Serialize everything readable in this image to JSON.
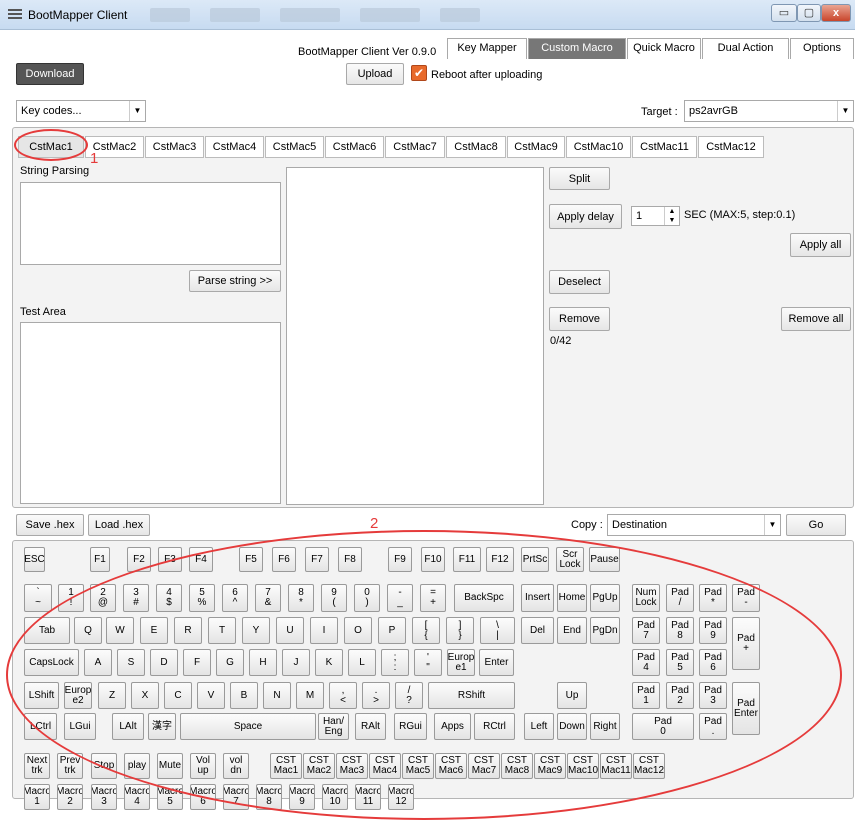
{
  "window": {
    "title": "BootMapper Client",
    "min": "▭",
    "max": "▢",
    "close": "x"
  },
  "header": {
    "version": "BootMapper Client Ver 0.9.0"
  },
  "tabs": [
    "Key Mapper",
    "Custom Macro",
    "Quick Macro",
    "Dual Action",
    "Options"
  ],
  "toolbar": {
    "download": "Download",
    "upload": "Upload",
    "reboot_label": "Reboot after uploading",
    "reboot_checked": true,
    "keycodes": "Key codes...",
    "target_label": "Target :",
    "target_value": "ps2avrGB"
  },
  "macro_tabs": [
    "CstMac1",
    "CstMac2",
    "CstMac3",
    "CstMac4",
    "CstMac5",
    "CstMac6",
    "CstMac7",
    "CstMac8",
    "CstMac9",
    "CstMac10",
    "CstMac11",
    "CstMac12"
  ],
  "macro": {
    "string_parsing": "String Parsing",
    "parse_button": "Parse string >>",
    "test_area": "Test Area",
    "split": "Split",
    "apply_delay": "Apply delay",
    "delay_value": "1",
    "sec_label": "SEC (MAX:5, step:0.1)",
    "apply_all": "Apply all",
    "deselect": "Deselect",
    "remove": "Remove",
    "remove_all": "Remove all",
    "counter": "0/42"
  },
  "bottom": {
    "save_hex": "Save .hex",
    "load_hex": "Load .hex",
    "copy_label": "Copy :",
    "destination": "Destination",
    "go": "Go"
  },
  "annotations": {
    "one": "1",
    "two": "2"
  },
  "keys": [
    {
      "l": "ESC"
    },
    {
      "l": "F1"
    },
    {
      "l": "F2"
    },
    {
      "l": "F3"
    },
    {
      "l": "F4"
    },
    {
      "l": "F5"
    },
    {
      "l": "F6"
    },
    {
      "l": "F7"
    },
    {
      "l": "F8"
    },
    {
      "l": "F9"
    },
    {
      "l": "F10"
    },
    {
      "l": "F11"
    },
    {
      "l": "F12"
    },
    {
      "l": "PrtSc"
    },
    {
      "l": "Scr\nLock"
    },
    {
      "l": "Pause"
    },
    {
      "l": "`\n~"
    },
    {
      "l": "1\n!"
    },
    {
      "l": "2\n@"
    },
    {
      "l": "3\n#"
    },
    {
      "l": "4\n$"
    },
    {
      "l": "5\n%"
    },
    {
      "l": "6\n^"
    },
    {
      "l": "7\n&"
    },
    {
      "l": "8\n*"
    },
    {
      "l": "9\n("
    },
    {
      "l": "0\n)"
    },
    {
      "l": "-\n_"
    },
    {
      "l": "=\n+"
    },
    {
      "l": "BackSpc"
    },
    {
      "l": "Insert"
    },
    {
      "l": "Home"
    },
    {
      "l": "PgUp"
    },
    {
      "l": "Num\nLock"
    },
    {
      "l": "Pad\n/"
    },
    {
      "l": "Pad\n*"
    },
    {
      "l": "Pad\n-"
    },
    {
      "l": "Tab"
    },
    {
      "l": "Q"
    },
    {
      "l": "W"
    },
    {
      "l": "E"
    },
    {
      "l": "R"
    },
    {
      "l": "T"
    },
    {
      "l": "Y"
    },
    {
      "l": "U"
    },
    {
      "l": "I"
    },
    {
      "l": "O"
    },
    {
      "l": "P"
    },
    {
      "l": "[\n{"
    },
    {
      "l": "]\n}"
    },
    {
      "l": "\\\n|"
    },
    {
      "l": "Del"
    },
    {
      "l": "End"
    },
    {
      "l": "PgDn"
    },
    {
      "l": "Pad\n7"
    },
    {
      "l": "Pad\n8"
    },
    {
      "l": "Pad\n9"
    },
    {
      "l": "Pad\n+"
    },
    {
      "l": "CapsLock"
    },
    {
      "l": "A"
    },
    {
      "l": "S"
    },
    {
      "l": "D"
    },
    {
      "l": "F"
    },
    {
      "l": "G"
    },
    {
      "l": "H"
    },
    {
      "l": "J"
    },
    {
      "l": "K"
    },
    {
      "l": "L"
    },
    {
      "l": ";\n:"
    },
    {
      "l": "'\n\""
    },
    {
      "l": "Europ\ne1"
    },
    {
      "l": "Enter"
    },
    {
      "l": "Pad\n4"
    },
    {
      "l": "Pad\n5"
    },
    {
      "l": "Pad\n6"
    },
    {
      "l": "LShift"
    },
    {
      "l": "Europ\ne2"
    },
    {
      "l": "Z"
    },
    {
      "l": "X"
    },
    {
      "l": "C"
    },
    {
      "l": "V"
    },
    {
      "l": "B"
    },
    {
      "l": "N"
    },
    {
      "l": "M"
    },
    {
      "l": ",\n<"
    },
    {
      "l": ".\n>"
    },
    {
      "l": "/\n?"
    },
    {
      "l": "RShift"
    },
    {
      "l": "Up"
    },
    {
      "l": "Pad\n1"
    },
    {
      "l": "Pad\n2"
    },
    {
      "l": "Pad\n3"
    },
    {
      "l": "Pad\nEnter"
    },
    {
      "l": "LCtrl"
    },
    {
      "l": "LGui"
    },
    {
      "l": "LAlt"
    },
    {
      "l": "漢字"
    },
    {
      "l": "Space"
    },
    {
      "l": "Han/\nEng"
    },
    {
      "l": "RAlt"
    },
    {
      "l": "RGui"
    },
    {
      "l": "Apps"
    },
    {
      "l": "RCtrl"
    },
    {
      "l": "Left"
    },
    {
      "l": "Down"
    },
    {
      "l": "Right"
    },
    {
      "l": "Pad\n0"
    },
    {
      "l": "Pad\n."
    },
    {
      "l": "Next\ntrk"
    },
    {
      "l": "Prev\ntrk"
    },
    {
      "l": "Stop"
    },
    {
      "l": "play"
    },
    {
      "l": "Mute"
    },
    {
      "l": "Vol\nup"
    },
    {
      "l": "vol\ndn"
    },
    {
      "l": "CST\nMac1"
    },
    {
      "l": "CST\nMac2"
    },
    {
      "l": "CST\nMac3"
    },
    {
      "l": "CST\nMac4"
    },
    {
      "l": "CST\nMac5"
    },
    {
      "l": "CST\nMac6"
    },
    {
      "l": "CST\nMac7"
    },
    {
      "l": "CST\nMac8"
    },
    {
      "l": "CST\nMac9"
    },
    {
      "l": "CST\nMac10"
    },
    {
      "l": "CST\nMac11"
    },
    {
      "l": "CST\nMac12"
    },
    {
      "l": "Macro\n1"
    },
    {
      "l": "Macro\n2"
    },
    {
      "l": "Macro\n3"
    },
    {
      "l": "Macro\n4"
    },
    {
      "l": "Macro\n5"
    },
    {
      "l": "Macro\n6"
    },
    {
      "l": "Macro\n7"
    },
    {
      "l": "Macro\n8"
    },
    {
      "l": "Macro\n9"
    },
    {
      "l": "Macro\n10"
    },
    {
      "l": "Macro\n11"
    },
    {
      "l": "Macro\n12"
    }
  ]
}
